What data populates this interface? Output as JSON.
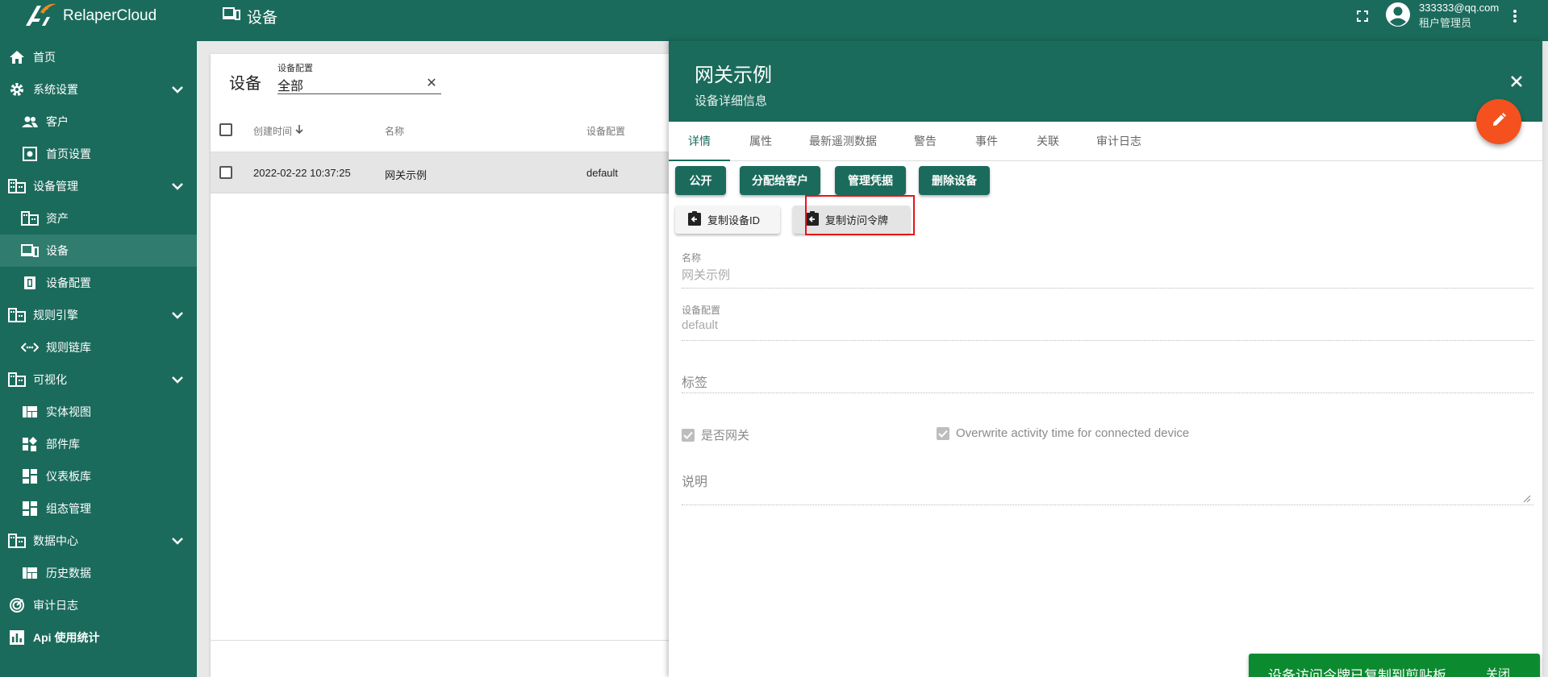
{
  "app": {
    "logo_text": "RelaperCloud",
    "page_heading": "设备"
  },
  "user": {
    "email": "333333@qq.com",
    "role": "租户管理员"
  },
  "sidebar": {
    "items": [
      {
        "label": "首页"
      },
      {
        "label": "系统设置"
      },
      {
        "label": "客户"
      },
      {
        "label": "首页设置"
      },
      {
        "label": "设备管理"
      },
      {
        "label": "资产"
      },
      {
        "label": "设备"
      },
      {
        "label": "设备配置"
      },
      {
        "label": "规则引擎"
      },
      {
        "label": "规则链库"
      },
      {
        "label": "可视化"
      },
      {
        "label": "实体视图"
      },
      {
        "label": "部件库"
      },
      {
        "label": "仪表板库"
      },
      {
        "label": "组态管理"
      },
      {
        "label": "数据中心"
      },
      {
        "label": "历史数据"
      },
      {
        "label": "审计日志"
      },
      {
        "label": "Api 使用统计"
      }
    ]
  },
  "device_list": {
    "title": "设备",
    "filter": {
      "label": "设备配置",
      "value": "全部"
    },
    "columns": [
      "创建时间",
      "名称",
      "设备配置"
    ],
    "rows": [
      {
        "created": "2022-02-22 10:37:25",
        "name": "网关示例",
        "profile": "default"
      }
    ]
  },
  "drawer": {
    "title": "网关示例",
    "subtitle": "设备详细信息",
    "tabs": [
      "详情",
      "属性",
      "最新遥测数据",
      "警告",
      "事件",
      "关联",
      "审计日志"
    ],
    "actions": [
      "公开",
      "分配给客户",
      "管理凭据",
      "删除设备"
    ],
    "copy_buttons": [
      "复制设备ID",
      "复制访问令牌"
    ],
    "fields": {
      "name_label": "名称",
      "name_value": "网关示例",
      "profile_label": "设备配置",
      "profile_value": "default",
      "label_placeholder": "标签",
      "gateway_label": "是否网关",
      "overwrite_label": "Overwrite activity time for connected device",
      "description_placeholder": "说明"
    }
  },
  "snackbar": {
    "text": "设备访问令牌已复制到剪贴板",
    "close": "关闭"
  },
  "colors": {
    "primary": "#1b6b5c",
    "sidebar_active": "#307c6e",
    "fab": "#f4511e",
    "snackbar": "#0c8a2f",
    "highlight": "#e8141a"
  }
}
